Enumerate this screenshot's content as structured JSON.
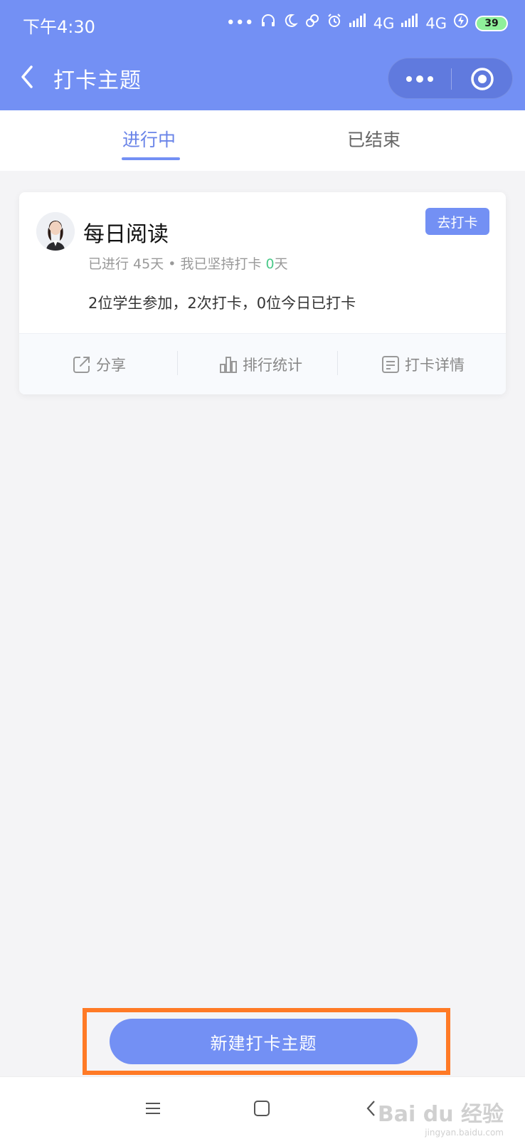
{
  "status_bar": {
    "time": "下午4:30",
    "network_1": "4G",
    "network_2": "4G",
    "battery": "39",
    "icons": [
      "more-dots-icon",
      "headset-icon",
      "moon-icon",
      "link-icon",
      "alarm-icon",
      "signal-icon",
      "signal-icon",
      "charging-icon",
      "battery-icon"
    ]
  },
  "nav": {
    "title": "打卡主题"
  },
  "tabs": [
    {
      "label": "进行中",
      "active": true
    },
    {
      "label": "已结束",
      "active": false
    }
  ],
  "card": {
    "title": "每日阅读",
    "go_button": "去打卡",
    "meta_prefix": "已进行 45天 • 我已坚持打卡 ",
    "meta_days": "0",
    "meta_suffix": "天",
    "summary": "2位学生参加，2次打卡，0位今日已打卡",
    "actions": [
      {
        "label": "分享",
        "icon": "share-icon"
      },
      {
        "label": "排行统计",
        "icon": "bar-chart-icon"
      },
      {
        "label": "打卡详情",
        "icon": "details-icon"
      }
    ]
  },
  "create_button": "新建打卡主题",
  "watermark": {
    "brand": "Bai du 经验",
    "url": "jingyan.baidu.com"
  },
  "colors": {
    "primary": "#7390f4",
    "highlight": "#ff7a26",
    "success": "#4cc98a"
  }
}
